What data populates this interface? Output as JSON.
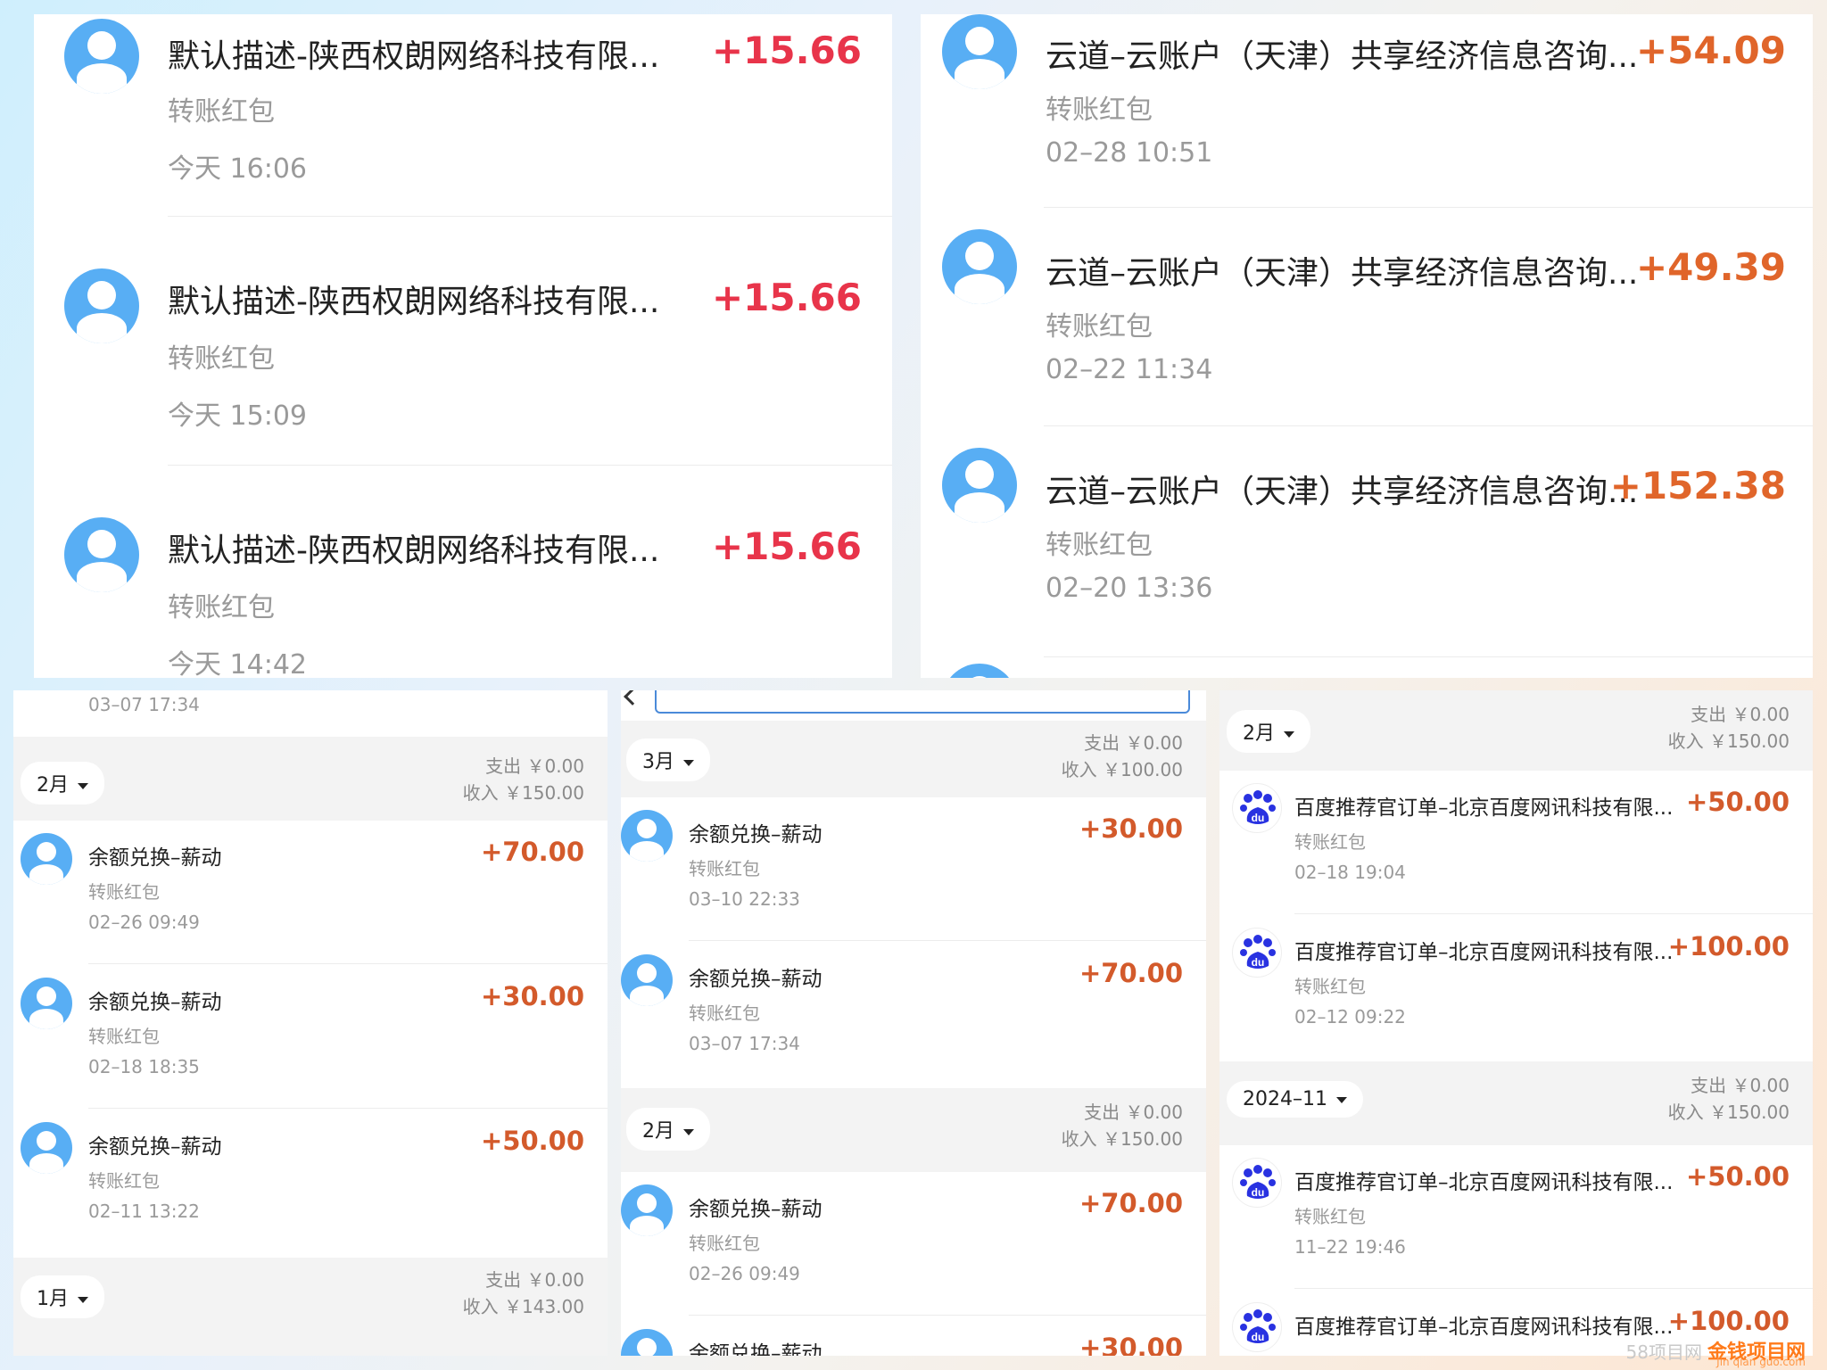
{
  "panel1": {
    "items": [
      {
        "title": "默认描述-陕西权朗网络科技有限...",
        "sub": "转账红包",
        "time": "今天 16:06",
        "amount": "+15.66"
      },
      {
        "title": "默认描述-陕西权朗网络科技有限...",
        "sub": "转账红包",
        "time": "今天 15:09",
        "amount": "+15.66"
      },
      {
        "title": "默认描述-陕西权朗网络科技有限...",
        "sub": "转账红包",
        "time": "今天 14:42",
        "amount": "+15.66"
      }
    ],
    "amount_color": "#e8344a"
  },
  "panel2": {
    "items": [
      {
        "title": "云道–云账户（天津）共享经济信息咨询...",
        "sub": "转账红包",
        "time": "02–28 10:51",
        "amount": "+54.09"
      },
      {
        "title": "云道–云账户（天津）共享经济信息咨询...",
        "sub": "转账红包",
        "time": "02–22 11:34",
        "amount": "+49.39"
      },
      {
        "title": "云道–云账户（天津）共享经济信息咨询...",
        "sub": "转账红包",
        "time": "02–20 13:36",
        "amount": "+152.38"
      }
    ],
    "amount_color": "#e0652a"
  },
  "panel3": {
    "top_time": "03–07 17:34",
    "month1": {
      "label": "2月",
      "expense": "支出 ￥0.00",
      "income": "收入 ￥150.00"
    },
    "items": [
      {
        "title": "余额兑换–薪动",
        "sub": "转账红包",
        "time": "02–26 09:49",
        "amount": "+70.00"
      },
      {
        "title": "余额兑换–薪动",
        "sub": "转账红包",
        "time": "02–18 18:35",
        "amount": "+30.00"
      },
      {
        "title": "余额兑换–薪动",
        "sub": "转账红包",
        "time": "02–11 13:22",
        "amount": "+50.00"
      }
    ],
    "month2": {
      "label": "1月",
      "expense": "支出 ￥0.00",
      "income": "收入 ￥143.00"
    }
  },
  "panel4": {
    "month1": {
      "label": "3月",
      "expense": "支出 ￥0.00",
      "income": "收入 ￥100.00"
    },
    "items1": [
      {
        "title": "余额兑换–薪动",
        "sub": "转账红包",
        "time": "03–10 22:33",
        "amount": "+30.00"
      },
      {
        "title": "余额兑换–薪动",
        "sub": "转账红包",
        "time": "03–07 17:34",
        "amount": "+70.00"
      }
    ],
    "month2": {
      "label": "2月",
      "expense": "支出 ￥0.00",
      "income": "收入 ￥150.00"
    },
    "items2": [
      {
        "title": "余额兑换–薪动",
        "sub": "转账红包",
        "time": "02–26 09:49",
        "amount": "+70.00"
      },
      {
        "title": "余额兑换–薪动",
        "amount": "+30.00"
      }
    ]
  },
  "panel5": {
    "month1": {
      "label": "2月",
      "expense": "支出 ￥0.00",
      "income": "收入 ￥150.00"
    },
    "items1": [
      {
        "title": "百度推荐官订单–北京百度网讯科技有限...",
        "sub": "转账红包",
        "time": "02–18 19:04",
        "amount": "+50.00"
      },
      {
        "title": "百度推荐官订单–北京百度网讯科技有限...",
        "sub": "转账红包",
        "time": "02–12 09:22",
        "amount": "+100.00"
      }
    ],
    "month2": {
      "label": "2024–11",
      "expense": "支出 ￥0.00",
      "income": "收入 ￥150.00"
    },
    "items2": [
      {
        "title": "百度推荐官订单–北京百度网讯科技有限...",
        "sub": "转账红包",
        "time": "11–22 19:46",
        "amount": "+50.00"
      },
      {
        "title": "百度推荐官订单–北京百度网讯科技有限...",
        "amount": "+100.00"
      }
    ]
  },
  "watermark": {
    "part1": "58项目网",
    "part2": "金钱项目网",
    "part3": "Jin qian guo.com"
  },
  "icons": {
    "avatar": "person-avatar-icon",
    "baidu": "baidu-paw-icon",
    "caret": "caret-down-icon",
    "back": "back-arrow-icon",
    "search": "search-icon"
  }
}
